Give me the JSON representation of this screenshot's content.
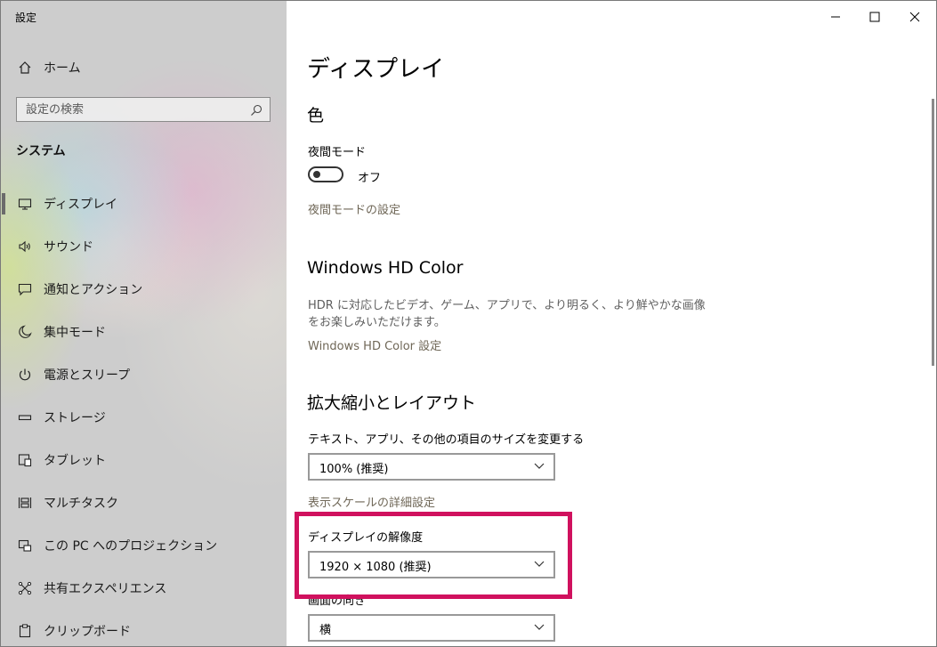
{
  "app": {
    "title": "設定"
  },
  "window_controls": {
    "minimize": "─",
    "maximize": "☐",
    "close": "✕"
  },
  "sidebar": {
    "home_label": "ホーム",
    "search_placeholder": "設定の検索",
    "section_title": "システム",
    "items": [
      {
        "label": "ディスプレイ",
        "icon": "monitor-icon",
        "active": true
      },
      {
        "label": "サウンド",
        "icon": "speaker-icon"
      },
      {
        "label": "通知とアクション",
        "icon": "notification-icon"
      },
      {
        "label": "集中モード",
        "icon": "moon-icon"
      },
      {
        "label": "電源とスリープ",
        "icon": "power-icon"
      },
      {
        "label": "ストレージ",
        "icon": "storage-icon"
      },
      {
        "label": "タブレット",
        "icon": "tablet-icon"
      },
      {
        "label": "マルチタスク",
        "icon": "multitask-icon"
      },
      {
        "label": "この PC へのプロジェクション",
        "icon": "projection-icon"
      },
      {
        "label": "共有エクスペリエンス",
        "icon": "share-icon"
      },
      {
        "label": "クリップボード",
        "icon": "clipboard-icon"
      }
    ]
  },
  "main": {
    "title": "ディスプレイ",
    "color_section": {
      "heading": "色",
      "night_mode_label": "夜間モード",
      "night_mode_state": "オフ",
      "night_mode_settings_link": "夜間モードの設定"
    },
    "hd_color_section": {
      "heading": "Windows HD Color",
      "description": "HDR に対応したビデオ、ゲーム、アプリで、より明るく、より鮮やかな画像をお楽しみいただけます。",
      "settings_link": "Windows HD Color 設定"
    },
    "scale_section": {
      "heading": "拡大縮小とレイアウト",
      "text_size_label": "テキスト、アプリ、その他の項目のサイズを変更する",
      "text_size_value": "100% (推奨)",
      "advanced_scale_link": "表示スケールの詳細設定",
      "resolution_label": "ディスプレイの解像度",
      "resolution_value": "1920 × 1080 (推奨)",
      "orientation_label": "画面の向き",
      "orientation_value": "横"
    }
  },
  "colors": {
    "highlight": "#d0115e",
    "link": "#6f6757"
  }
}
